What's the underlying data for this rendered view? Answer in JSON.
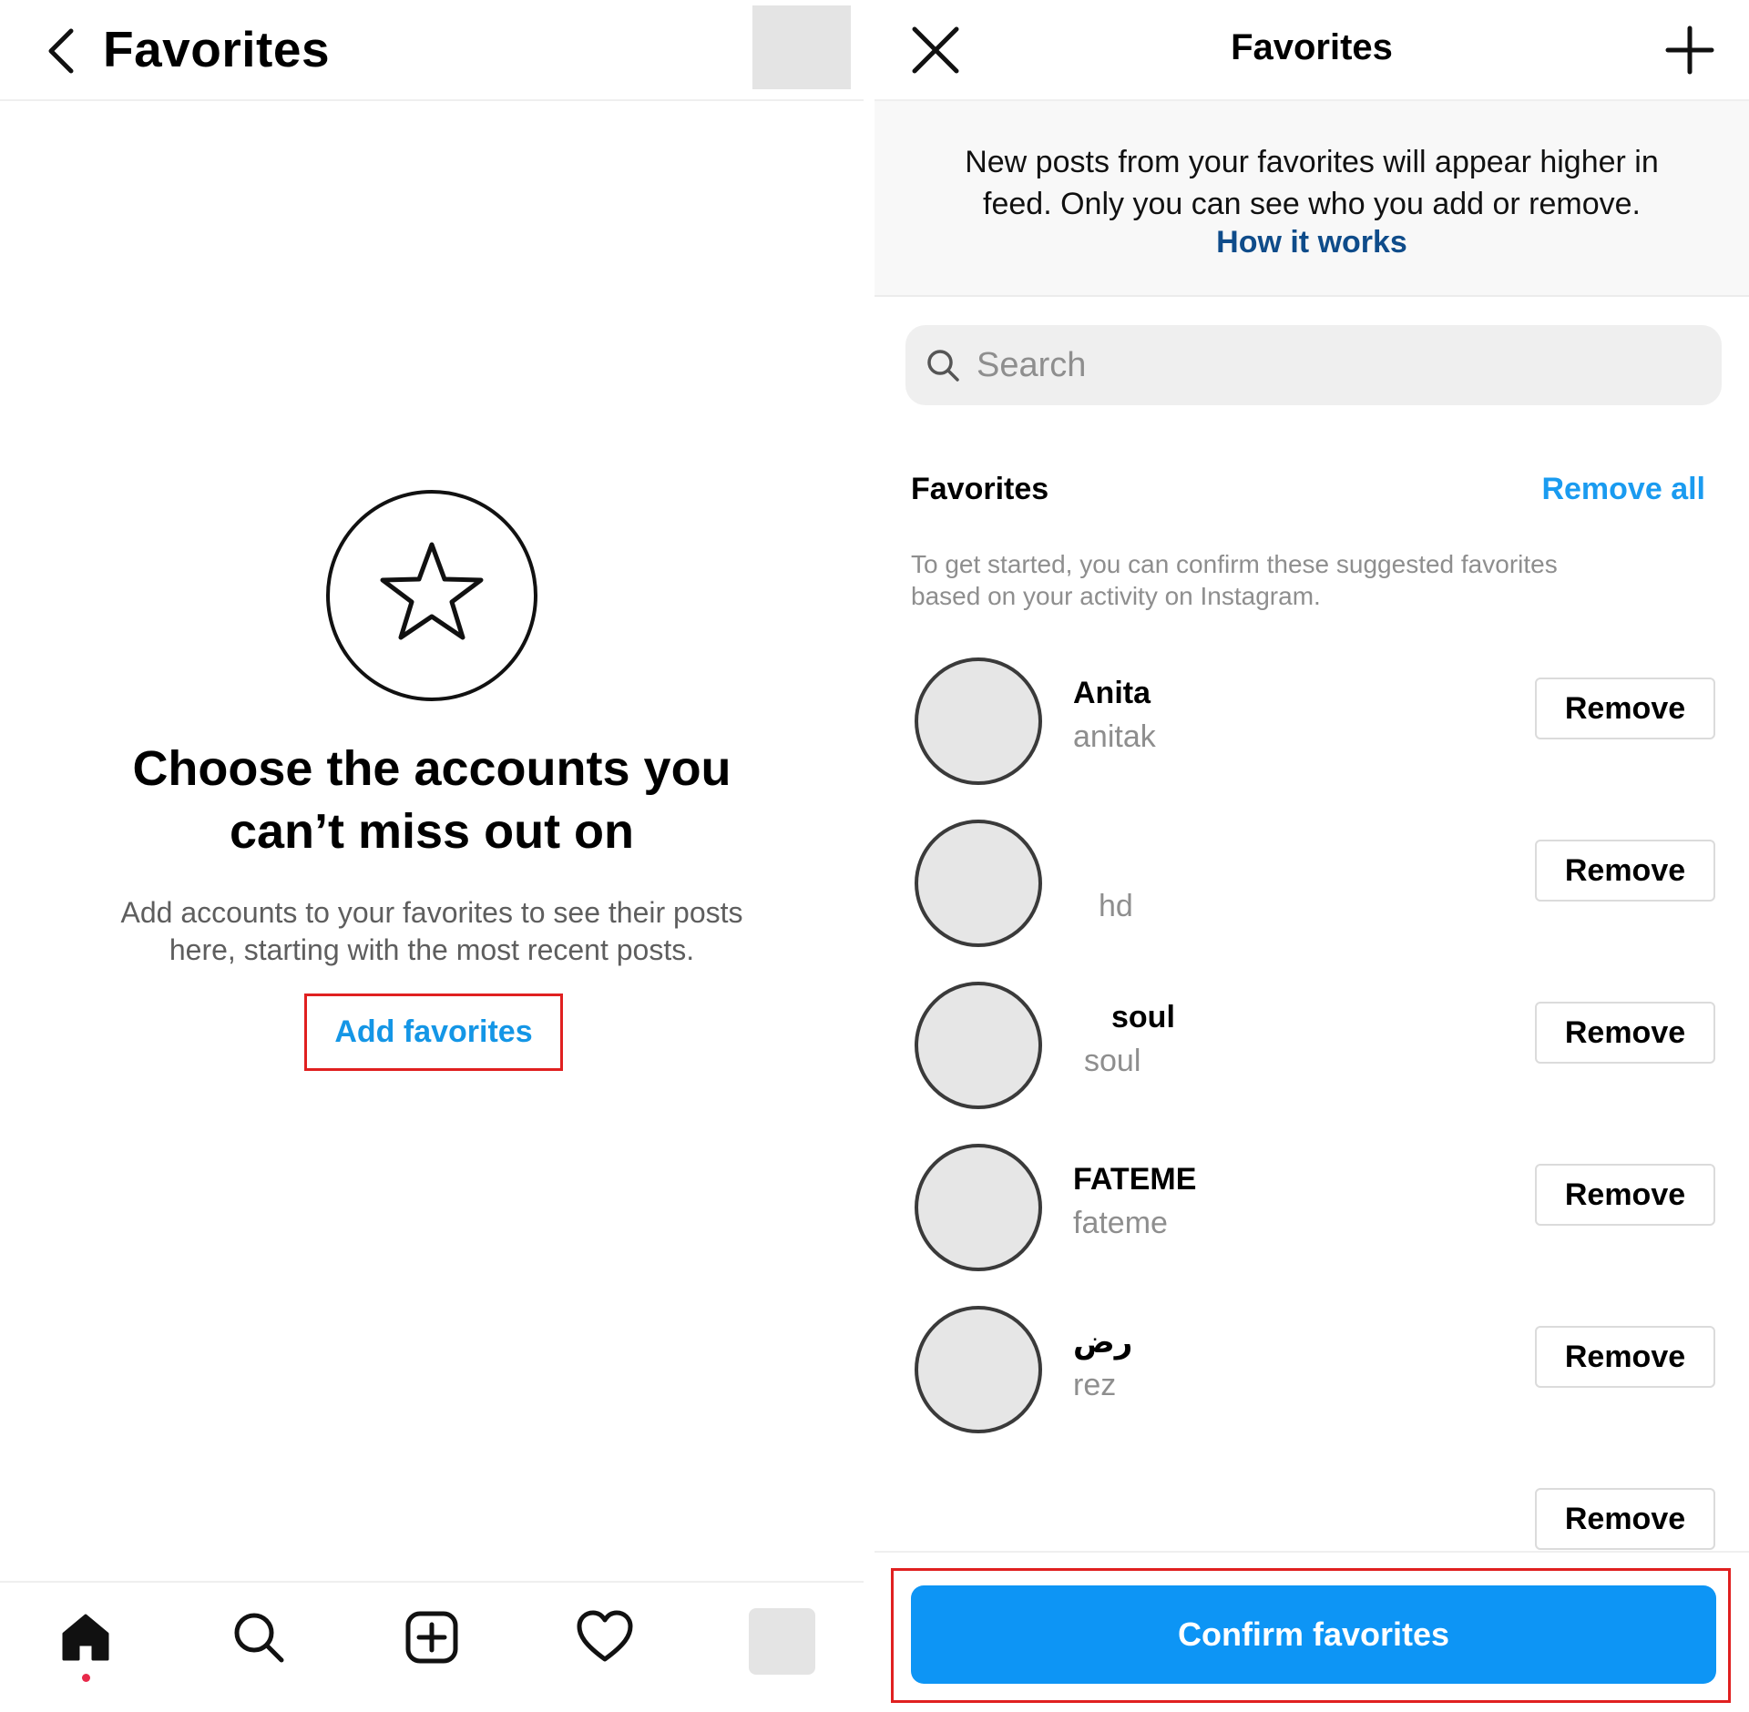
{
  "left": {
    "header": {
      "title": "Favorites"
    },
    "empty_state": {
      "heading_line1": "Choose the accounts you",
      "heading_line2": "can’t miss out on",
      "description_line1": "Add accounts to your favorites to see their posts",
      "description_line2": "here, starting with the most recent posts.",
      "add_button": "Add favorites"
    },
    "tabbar": [
      "home-icon",
      "search-icon",
      "create-icon",
      "heart-icon",
      "profile-avatar"
    ]
  },
  "right": {
    "header": {
      "title": "Favorites"
    },
    "banner": {
      "line1": "New posts from your favorites will appear higher in",
      "line2": "feed. Only you can see who you add or remove.",
      "link": "How it works"
    },
    "search": {
      "placeholder": "Search"
    },
    "section": {
      "title": "Favorites",
      "remove_all": "Remove all",
      "hint_line1": "To get started, you can confirm these suggested favorites",
      "hint_line2": "based on your activity on Instagram."
    },
    "accounts": [
      {
        "name": "Anita",
        "username": "anitak"
      },
      {
        "name": "",
        "username": "hd"
      },
      {
        "name": "soul",
        "username": "soul"
      },
      {
        "name": "FATEME",
        "username": "fateme"
      },
      {
        "name": "رض",
        "username": "rez"
      },
      {
        "name": "",
        "username": ""
      }
    ],
    "remove_label": "Remove",
    "confirm_button": "Confirm favorites"
  },
  "colors": {
    "link_blue": "#1a9bf0",
    "confirm_blue": "#0d95f5",
    "highlight_red": "#e02020"
  }
}
